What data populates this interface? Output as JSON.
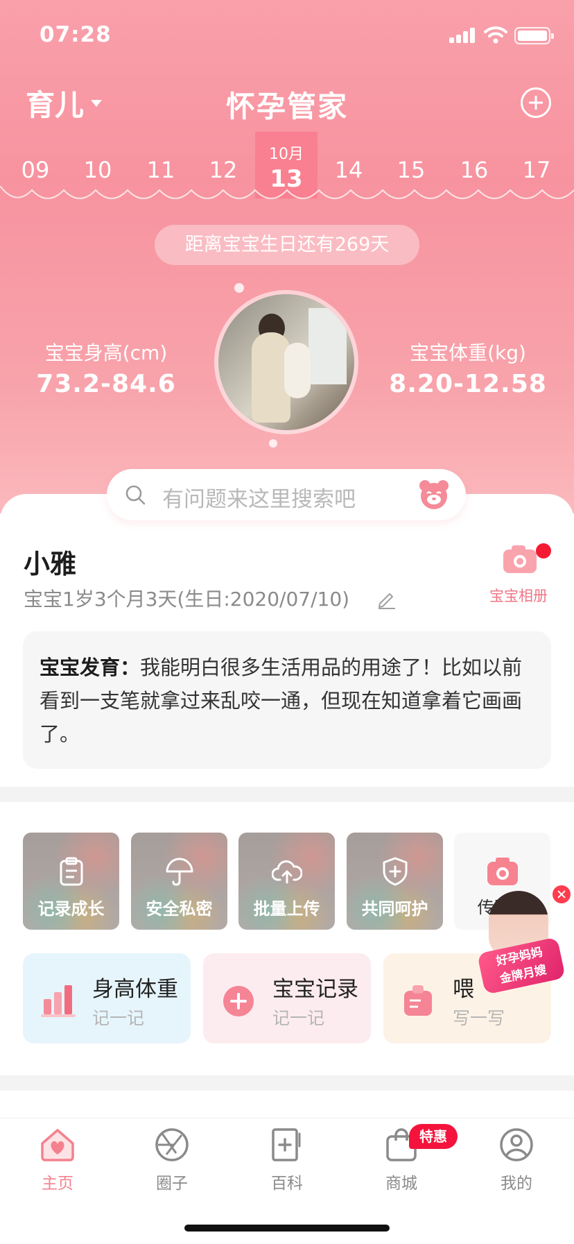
{
  "status_bar": {
    "time": "07:28"
  },
  "header": {
    "mode": "育儿",
    "title": "怀孕管家"
  },
  "dates": {
    "before": [
      "09",
      "10",
      "11",
      "12"
    ],
    "selected": {
      "month": "10月",
      "day": "13"
    },
    "after": [
      "14",
      "15",
      "16",
      "17"
    ]
  },
  "countdown": "距离宝宝生日还有269天",
  "stats": {
    "height": {
      "label": "宝宝身高(cm)",
      "value": "73.2-84.6"
    },
    "weight": {
      "label": "宝宝体重(kg)",
      "value": "8.20-12.58"
    }
  },
  "search": {
    "placeholder": "有问题来这里搜索吧"
  },
  "baby": {
    "name": "小雅",
    "info": "宝宝1岁3个月3天(生日:2020/07/10)",
    "album_label": "宝宝相册"
  },
  "development": {
    "title": "宝宝发育：",
    "text": "我能明白很多生活用品的用途了！比如以前看到一支笔就拿过来乱咬一通，但现在知道拿着它画画了。"
  },
  "tiles": [
    {
      "label": "记录成长",
      "icon": "clipboard-icon"
    },
    {
      "label": "安全私密",
      "icon": "umbrella-icon"
    },
    {
      "label": "批量上传",
      "icon": "cloud-upload-icon"
    },
    {
      "label": "共同呵护",
      "icon": "shield-plus-icon"
    },
    {
      "label": "传照片",
      "icon": "camera-icon"
    }
  ],
  "records": [
    {
      "title": "身高体重",
      "sub": "记一记",
      "bg": "#e8f6fd",
      "icon": "bar-chart-icon"
    },
    {
      "title": "宝宝记录",
      "sub": "记一记",
      "bg": "#fdeef0",
      "icon": "plus-circle-icon"
    },
    {
      "title": "喂",
      "sub": "写一写",
      "bg": "#fdf3e9",
      "icon": "bottle-icon"
    }
  ],
  "promo": {
    "line1": "好孕妈妈",
    "line2": "金牌月嫂"
  },
  "tabbar": [
    {
      "label": "主页",
      "icon": "home-heart-icon",
      "active": true
    },
    {
      "label": "圈子",
      "icon": "aperture-icon",
      "active": false
    },
    {
      "label": "百科",
      "icon": "book-plus-icon",
      "active": false
    },
    {
      "label": "商城",
      "icon": "shopping-bag-icon",
      "active": false,
      "badge": "特惠"
    },
    {
      "label": "我的",
      "icon": "user-circle-icon",
      "active": false
    }
  ],
  "colors": {
    "brand_pink": "#f7939f",
    "accent": "#f4818e",
    "badge_red": "#f4133c"
  }
}
